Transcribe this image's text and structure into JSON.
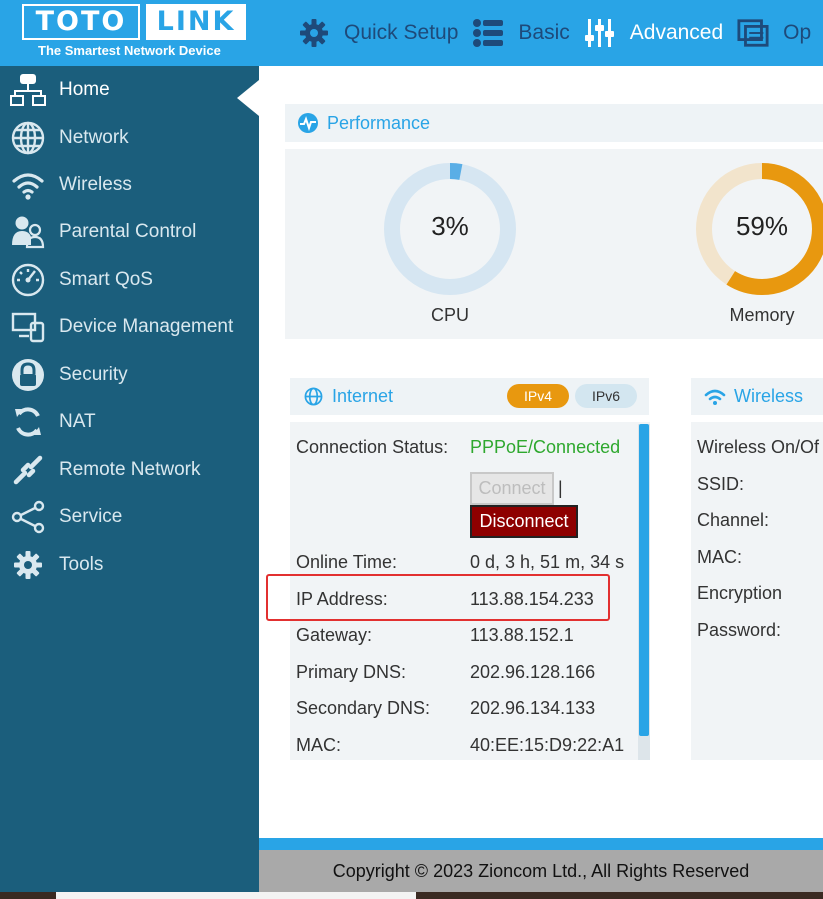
{
  "header": {
    "logo_left": "TOTO",
    "logo_right": "LINK",
    "tagline": "The Smartest Network Device",
    "nav": [
      {
        "label": "Quick Setup",
        "icon": "gear-icon",
        "active": false
      },
      {
        "label": "Basic",
        "icon": "list-icon",
        "active": false
      },
      {
        "label": "Advanced",
        "icon": "sliders-icon",
        "active": true
      },
      {
        "label": "Op",
        "icon": "monitor-icon",
        "active": false
      }
    ]
  },
  "sidebar": {
    "items": [
      {
        "label": "Home",
        "icon": "network-home-icon",
        "active": true
      },
      {
        "label": "Network",
        "icon": "globe-icon"
      },
      {
        "label": "Wireless",
        "icon": "wifi-icon"
      },
      {
        "label": "Parental Control",
        "icon": "parent-child-icon"
      },
      {
        "label": "Smart QoS",
        "icon": "speedometer-icon"
      },
      {
        "label": "Device Management",
        "icon": "devices-icon"
      },
      {
        "label": "Security",
        "icon": "lock-icon"
      },
      {
        "label": "NAT",
        "icon": "refresh-icon"
      },
      {
        "label": "Remote Network",
        "icon": "link-icon"
      },
      {
        "label": "Service",
        "icon": "share-icon"
      },
      {
        "label": "Tools",
        "icon": "gear-icon"
      }
    ]
  },
  "performance": {
    "title": "Performance",
    "cpu": {
      "label": "CPU",
      "value_text": "3%",
      "value": 3,
      "color": "#5aaee6",
      "track": "#d6e6f2"
    },
    "memory": {
      "label": "Memory",
      "value_text": "59%",
      "value": 59,
      "color": "#e8980f",
      "track": "#f2e4cc"
    }
  },
  "internet": {
    "title": "Internet",
    "tab_ipv4": "IPv4",
    "tab_ipv6": "IPv6",
    "connect_label": "Connect",
    "separator": "|",
    "disconnect_label": "Disconnect",
    "rows": {
      "status_label": "Connection Status:",
      "status_value": "PPPoE/Connected",
      "online_label": "Online Time:",
      "online_value": "0 d, 3 h, 51 m, 34 s",
      "ip_label": "IP Address:",
      "ip_value": "113.88.154.233",
      "gateway_label": "Gateway:",
      "gateway_value": "113.88.152.1",
      "pdns_label": "Primary DNS:",
      "pdns_value": "202.96.128.166",
      "sdns_label": "Secondary DNS:",
      "sdns_value": "202.96.134.133",
      "mac_label": "MAC:",
      "mac_value": "40:EE:15:D9:22:A1"
    }
  },
  "wireless": {
    "title": "Wireless",
    "rows": [
      "Wireless On/Of",
      "SSID:",
      "Channel:",
      "MAC:",
      "Encryption",
      "Password:"
    ]
  },
  "footer": {
    "copyright": "Copyright © 2023 Zioncom Ltd., All Rights Reserved"
  },
  "colors": {
    "header_blue": "#29a4e6",
    "sidebar": "#1b5e7c",
    "connected_green": "#2ea82e",
    "highlight_red": "#e23030"
  }
}
